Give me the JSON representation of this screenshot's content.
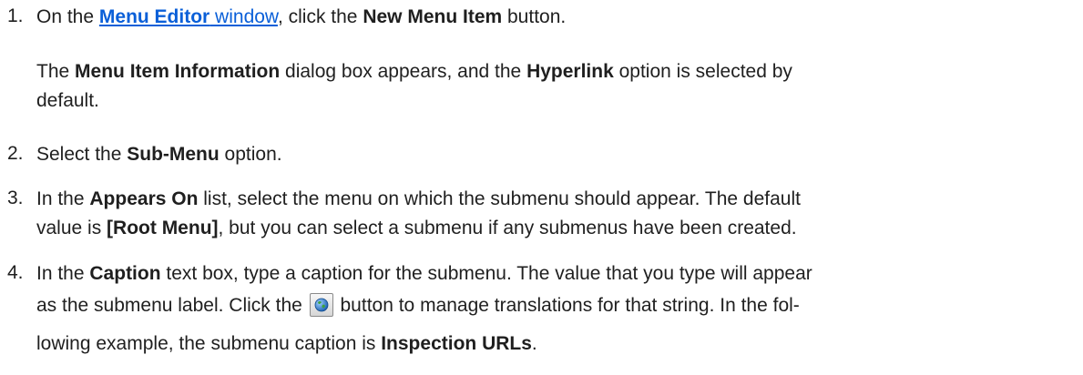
{
  "steps": [
    {
      "number": "1.",
      "text_a": "On the ",
      "link_bold": "Menu Editor",
      "link_rest": " window",
      "text_b": ", click the ",
      "bold_a": "New Menu Item",
      "text_c": " button.",
      "note_a": "The ",
      "note_bold_a": "Menu Item Information",
      "note_b": " dialog box appears, and the ",
      "note_bold_b": "Hyperlink",
      "note_c": " option is selected by",
      "note_d": "default."
    },
    {
      "number": "2.",
      "text_a": "Select the ",
      "bold_a": "Sub-Menu",
      "text_b": " option."
    },
    {
      "number": "3.",
      "text_a": "In the ",
      "bold_a": "Appears On",
      "text_b": " list, select the menu on which the submenu should appear. The default",
      "text_c": "value is ",
      "bold_b": "[Root Menu]",
      "text_d": ", but you can select a submenu if any submenus have been created."
    },
    {
      "number": "4.",
      "text_a": "In the ",
      "bold_a": "Caption",
      "text_b": " text box, type a caption for the submenu. The value that you type will appear",
      "text_c": "as the submenu label.  Click the ",
      "text_d": " button to manage translations for that string. In the fol-",
      "text_e": "lowing example, the submenu caption is ",
      "bold_b": "Inspection URLs",
      "text_f": ".",
      "button_icon": "globe-icon"
    }
  ]
}
